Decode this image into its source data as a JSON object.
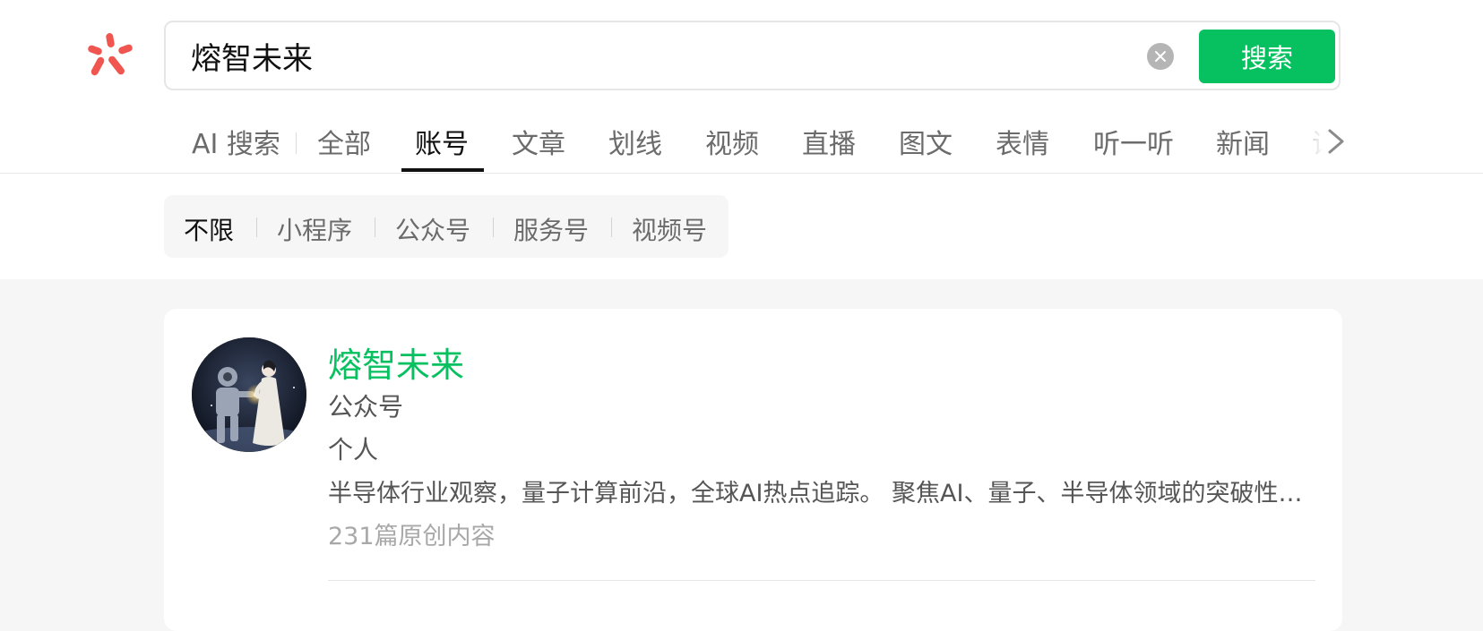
{
  "colors": {
    "accent": "#07c160",
    "logo": "#f05550",
    "page_bg": "#f6f6f6"
  },
  "logo": {
    "icon": "wechat-search-logo-icon"
  },
  "search": {
    "value": "熔智未来",
    "clear_icon": "close-circle-icon",
    "button_label": "搜索"
  },
  "tabs": [
    {
      "label": "AI 搜索"
    },
    {
      "label": "全部"
    },
    {
      "label": "账号",
      "active": true
    },
    {
      "label": "文章"
    },
    {
      "label": "划线"
    },
    {
      "label": "视频"
    },
    {
      "label": "直播"
    },
    {
      "label": "图文"
    },
    {
      "label": "表情"
    },
    {
      "label": "听一听"
    },
    {
      "label": "新闻"
    },
    {
      "label": "识"
    }
  ],
  "tabs_next_icon": "chevron-right-icon",
  "filters": [
    {
      "label": "不限",
      "active": true
    },
    {
      "label": "小程序"
    },
    {
      "label": "公众号"
    },
    {
      "label": "服务号"
    },
    {
      "label": "视频号"
    }
  ],
  "result": {
    "name": "熔智未来",
    "type": "公众号",
    "subject": "个人",
    "description": "半导体行业观察，量子计算前沿，全球AI热点追踪。 聚焦AI、量子、半导体领域的突破性进展与产业动态",
    "original_count": "231篇原创内容"
  }
}
